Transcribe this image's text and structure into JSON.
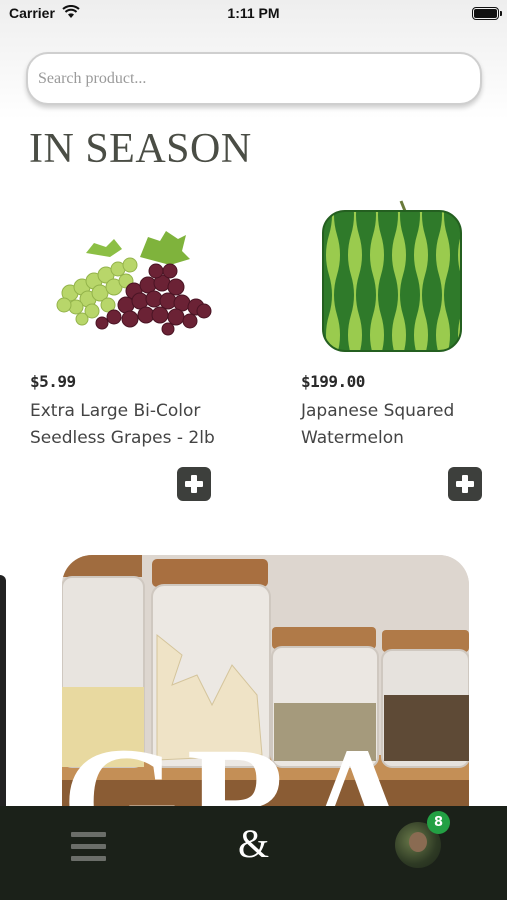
{
  "status_bar": {
    "carrier": "Carrier",
    "time": "1:11 PM"
  },
  "search": {
    "placeholder": "Search product..."
  },
  "section": {
    "title": "IN SEASON"
  },
  "products": [
    {
      "price": "$5.99",
      "name": "Extra Large Bi-Color Seedless Grapes - 2lb"
    },
    {
      "price": "$199.00",
      "name": "Japanese Squared Watermelon"
    }
  ],
  "banner": {
    "overlay_text": "GRA"
  },
  "bottom_nav": {
    "logo": "&",
    "badge_count": "8"
  },
  "colors": {
    "accent_dark": "#1b2119",
    "badge": "#23a044",
    "add_button": "#3d3f3c"
  },
  "icons": {
    "menu": "hamburger-icon",
    "add": "plus-square-icon",
    "wifi": "wifi-icon",
    "battery": "battery-icon"
  }
}
